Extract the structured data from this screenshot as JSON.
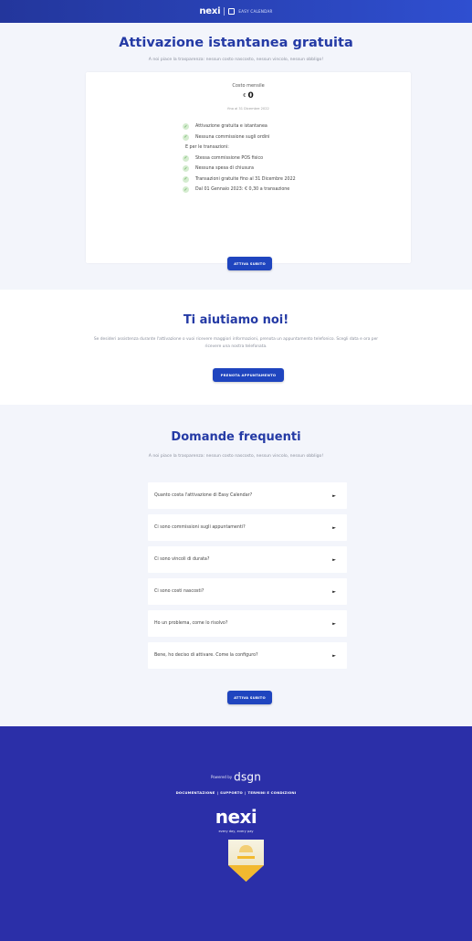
{
  "header": {
    "brand": "nexi",
    "product": "EASY CALENDAR"
  },
  "activation": {
    "title": "Attivazione istantanea gratuita",
    "subtitle": "A noi piace la trasparenza: nessun costo nascosto, nessun vincolo, nessun obbligo!",
    "cost_label": "Costo mensile",
    "currency": "€",
    "cost_value": "0",
    "cost_until": "fino al 31 Dicembre 2022",
    "features": [
      {
        "text": "Attivazione gratuita e istantanea",
        "check": true
      },
      {
        "text": "Nessuna commissione sugli ordini",
        "check": true
      },
      {
        "text": "E per le transazioni:",
        "check": false
      },
      {
        "text": "Stessa commissione POS fisico",
        "check": true
      },
      {
        "text": "Nessuna spesa di chiusura",
        "check": true
      },
      {
        "text": "Transazioni gratuite fino al 31 Dicembre 2022",
        "check": true
      },
      {
        "text": "Dal 01 Gennaio 2023: € 0,30 a transazione",
        "check": true
      }
    ],
    "button": "ATTIVA SUBITO"
  },
  "help": {
    "title": "Ti aiutiamo noi!",
    "description": "Se desideri assistenza durante l'attivazione o vuoi ricevere maggiori informazioni, prenota un appuntamento telefonico. Scegli data e ora per ricevere una nostra telefonata.",
    "button": "PRENOTA APPUNTAMENTO"
  },
  "faq": {
    "title": "Domande frequenti",
    "subtitle": "A noi piace la trasparenza: nessun costo nascosto, nessun vincolo, nessun obbligo!",
    "items": [
      "Quanto costa l'attivazione di Easy Calendar?",
      "Ci sono commissioni sugli appuntamenti?",
      "Ci sono vincoli di durata?",
      "Ci sono costi nascosti?",
      "Ho un problema, come lo risolvo?",
      "Bene, ho deciso di attivare. Come la configuro?"
    ],
    "button": "ATTIVA SUBITO"
  },
  "footer": {
    "powered_by": "Powered by",
    "powered_brand": "dsgn",
    "links": [
      "DOCUMENTAZIONE",
      "SUPPORTO",
      "TERMINI E CONDIZIONI"
    ],
    "logo": "nexi",
    "tagline": "every day, every pay"
  },
  "colors": {
    "primary_blue": "#243aa5",
    "button_blue": "#1f45bf",
    "footer_bg": "#2b2fa8",
    "check_green": "#55a44c"
  }
}
